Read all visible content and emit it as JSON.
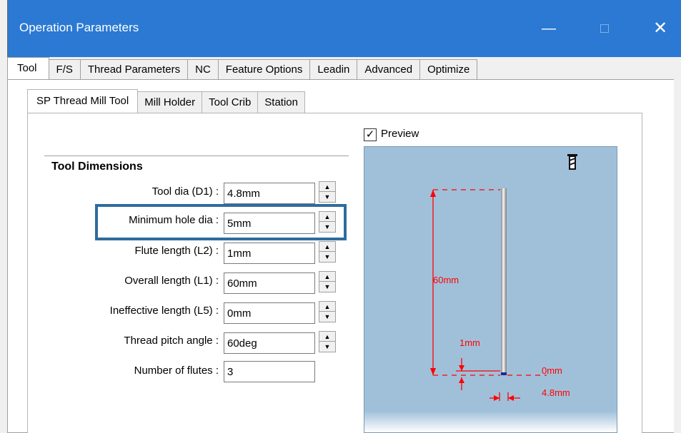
{
  "window": {
    "title": "Operation Parameters",
    "minimize_glyph": "—",
    "close_glyph": "✕"
  },
  "tabs_top": [
    "Tool",
    "F/S",
    "Thread Parameters",
    "NC",
    "Feature Options",
    "Leadin",
    "Advanced",
    "Optimize"
  ],
  "tabs_sub": [
    "SP Thread Mill Tool",
    "Mill Holder",
    "Tool Crib",
    "Station"
  ],
  "group": {
    "title": "Tool Dimensions",
    "fields": [
      {
        "label": "Tool dia (D1) :",
        "value": "4.8mm",
        "spin": true
      },
      {
        "label": "Minimum hole dia :",
        "value": "5mm",
        "spin": true,
        "highlighted": true
      },
      {
        "label": "Flute length (L2) :",
        "value": "1mm",
        "spin": true
      },
      {
        "label": "Overall length (L1) :",
        "value": "60mm",
        "spin": true
      },
      {
        "label": "Ineffective length (L5) :",
        "value": "0mm",
        "spin": true
      },
      {
        "label": "Thread pitch angle :",
        "value": "60deg",
        "spin": true
      },
      {
        "label": "Number of flutes :",
        "value": "3",
        "spin": false
      }
    ]
  },
  "preview": {
    "label": "Preview",
    "checked": true,
    "dimensions": {
      "overall": "60mm",
      "flute": "1mm",
      "ineffective": "0mm",
      "diameter": "4.8mm"
    }
  },
  "colors": {
    "titlebar": "#2b79d3",
    "highlight": "#2e6c9e",
    "preview_bg": "#a0c0da",
    "dimension": "#ff0000"
  },
  "icons": {
    "tool_type": "thread-mill-icon",
    "spin_up": "spin-up-icon",
    "spin_down": "spin-down-icon",
    "checkbox": "checkmark-icon"
  }
}
